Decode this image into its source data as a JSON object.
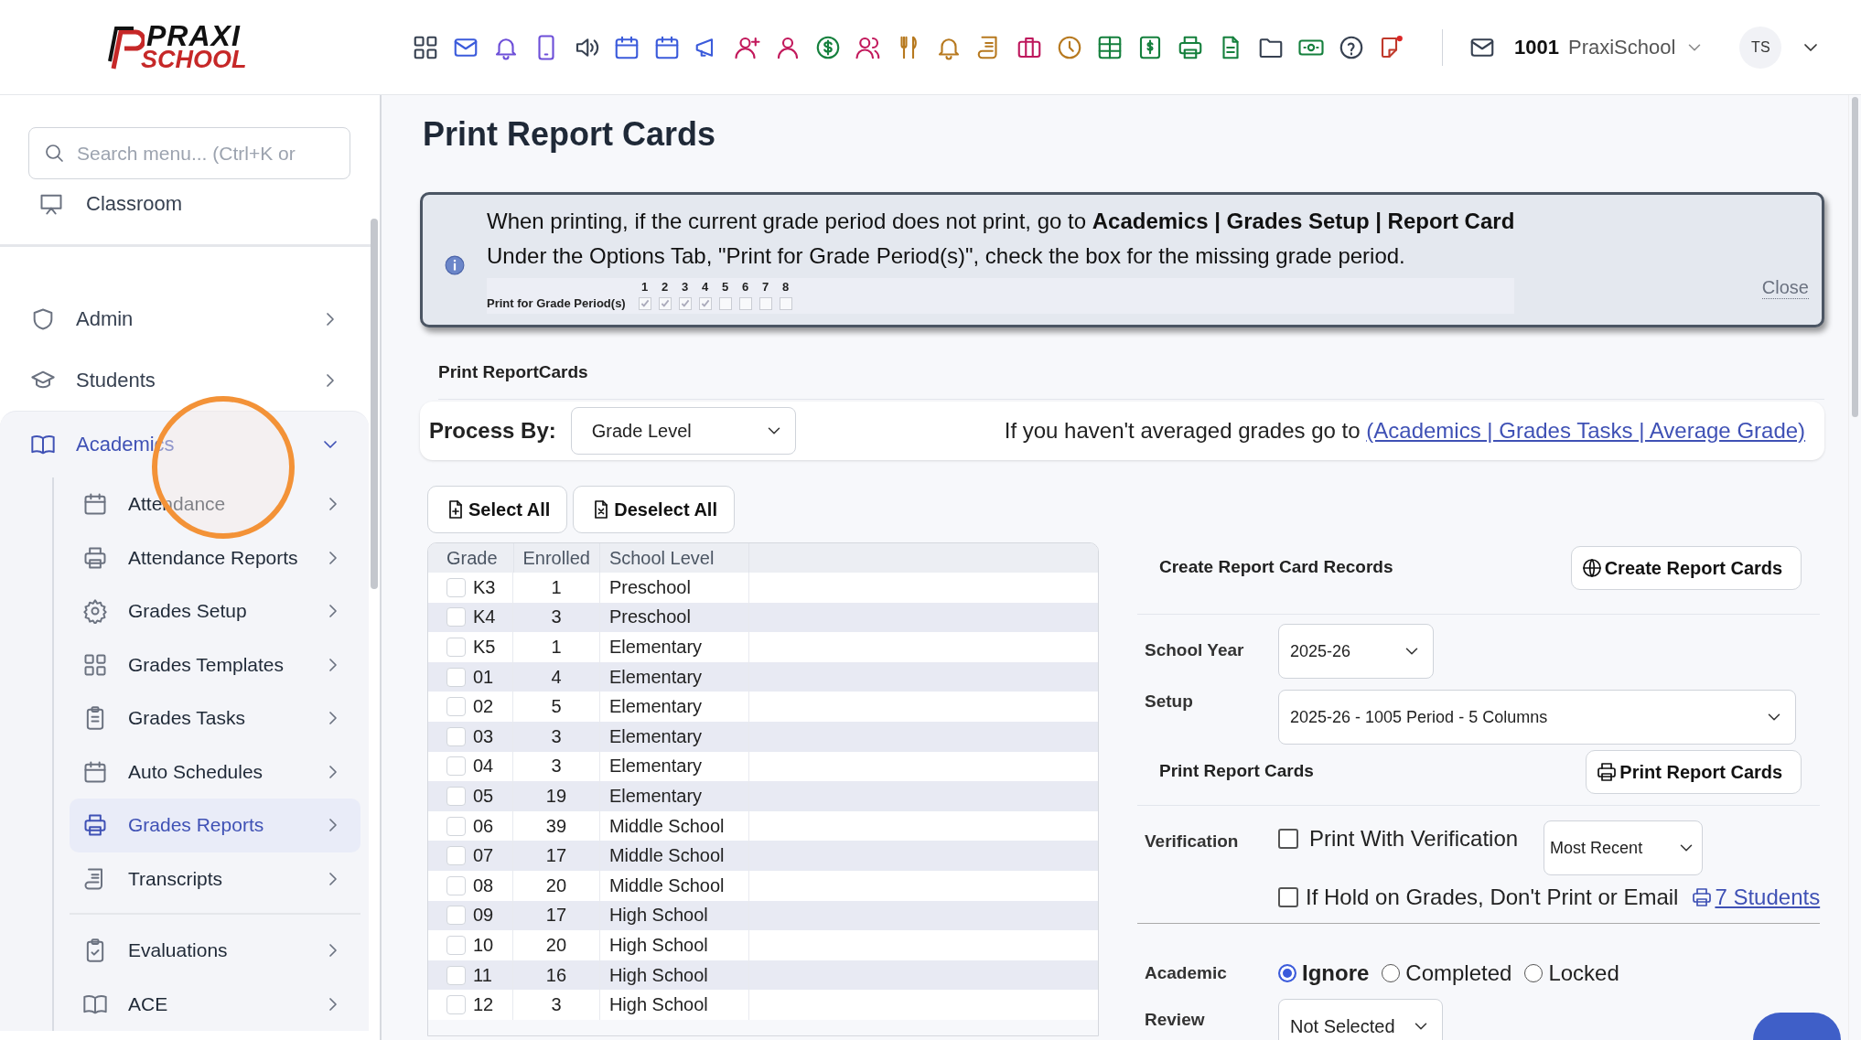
{
  "header": {
    "logo_top": "PRAXI",
    "logo_bottom": "SCHOOL",
    "school_code": "1001",
    "school_name": "PraxiSchool",
    "avatar": "TS"
  },
  "sidebar": {
    "search": {
      "placeholder": "Search menu... (Ctrl+K or"
    },
    "pinned": "Classroom",
    "items": [
      {
        "label": "Admin",
        "expanded": false,
        "selected": false
      },
      {
        "label": "Students",
        "expanded": false,
        "selected": false
      },
      {
        "label": "Academics",
        "expanded": true,
        "selected": true,
        "children": [
          {
            "label": "Attendance",
            "selected": false
          },
          {
            "label": "Attendance Reports",
            "selected": false
          },
          {
            "label": "Grades Setup",
            "selected": false
          },
          {
            "label": "Grades Templates",
            "selected": false
          },
          {
            "label": "Grades Tasks",
            "selected": false
          },
          {
            "label": "Auto Schedules",
            "selected": false
          },
          {
            "label": "Grades Reports",
            "selected": true
          },
          {
            "label": "Transcripts",
            "selected": false
          },
          {
            "label": "Evaluations",
            "selected": false
          },
          {
            "label": "ACE",
            "selected": false
          }
        ]
      }
    ]
  },
  "page_title": "Print Report Cards",
  "notice": {
    "line1": "When printing, if the current grade period does not print, go to **Academics | Grades Setup | Report Card**",
    "line2": "Under the Options Tab, \"Print for Grade Period(s)\", check the box for the missing grade period.",
    "period_label": "Print for Grade Period(s)",
    "periods": [
      {
        "number": "1",
        "checked": true
      },
      {
        "number": "2",
        "checked": true
      },
      {
        "number": "3",
        "checked": true
      },
      {
        "number": "4",
        "checked": true
      },
      {
        "number": "5",
        "checked": false
      },
      {
        "number": "6",
        "checked": false
      },
      {
        "number": "7",
        "checked": false
      },
      {
        "number": "8",
        "checked": false
      }
    ],
    "close": "Close"
  },
  "section_title": "Print ReportCards",
  "process": {
    "label": "Process By:",
    "value": "Grade Level",
    "hint": "If you haven't averaged grades go to",
    "link": "(Academics | Grades Tasks | Average Grade)"
  },
  "buttons": [
    {
      "kind": "select",
      "label": "Select All"
    },
    {
      "kind": "deselect",
      "label": "Deselect All"
    }
  ],
  "table": {
    "columns": [
      "Grade",
      "Enrolled",
      "School Level"
    ],
    "rows": [
      {
        "grade": "K3",
        "enrolled": "1",
        "level": "Preschool",
        "checked": false
      },
      {
        "grade": "K4",
        "enrolled": "3",
        "level": "Preschool",
        "checked": false
      },
      {
        "grade": "K5",
        "enrolled": "1",
        "level": "Elementary",
        "checked": false
      },
      {
        "grade": "01",
        "enrolled": "4",
        "level": "Elementary",
        "checked": false
      },
      {
        "grade": "02",
        "enrolled": "5",
        "level": "Elementary",
        "checked": false
      },
      {
        "grade": "03",
        "enrolled": "3",
        "level": "Elementary",
        "checked": false
      },
      {
        "grade": "04",
        "enrolled": "3",
        "level": "Elementary",
        "checked": false
      },
      {
        "grade": "05",
        "enrolled": "19",
        "level": "Elementary",
        "checked": false
      },
      {
        "grade": "06",
        "enrolled": "39",
        "level": "Middle School",
        "checked": false
      },
      {
        "grade": "07",
        "enrolled": "17",
        "level": "Middle School",
        "checked": false
      },
      {
        "grade": "08",
        "enrolled": "20",
        "level": "Middle School",
        "checked": false
      },
      {
        "grade": "09",
        "enrolled": "17",
        "level": "High School",
        "checked": false
      },
      {
        "grade": "10",
        "enrolled": "20",
        "level": "High School",
        "checked": false
      },
      {
        "grade": "11",
        "enrolled": "16",
        "level": "High School",
        "checked": false
      },
      {
        "grade": "12",
        "enrolled": "3",
        "level": "High School",
        "checked": false
      }
    ]
  },
  "panel": {
    "create_title": "Create Report Card Records",
    "create_button": "Create Report Cards",
    "school_year": {
      "label": "School Year",
      "value": "2025-26"
    },
    "setup": {
      "label": "Setup",
      "value": "2025-26 - 1005 Period - 5 Columns"
    },
    "print_title": "Print Report Cards",
    "print_button": "Print Report Cards",
    "verification": {
      "label": "Verification",
      "option": {
        "label": "Print With Verification",
        "checked": false
      },
      "mode": "Most Recent"
    },
    "hold": {
      "label": "If Hold on Grades, Don't Print or Email",
      "checked": false,
      "link": "7 Students"
    },
    "academic": {
      "label": "Academic",
      "options": [
        {
          "label": "Ignore",
          "selected": true
        },
        {
          "label": "Completed",
          "selected": false
        },
        {
          "label": "Locked",
          "selected": false
        }
      ]
    },
    "review": {
      "label": "Review",
      "value": "Not Selected"
    }
  }
}
